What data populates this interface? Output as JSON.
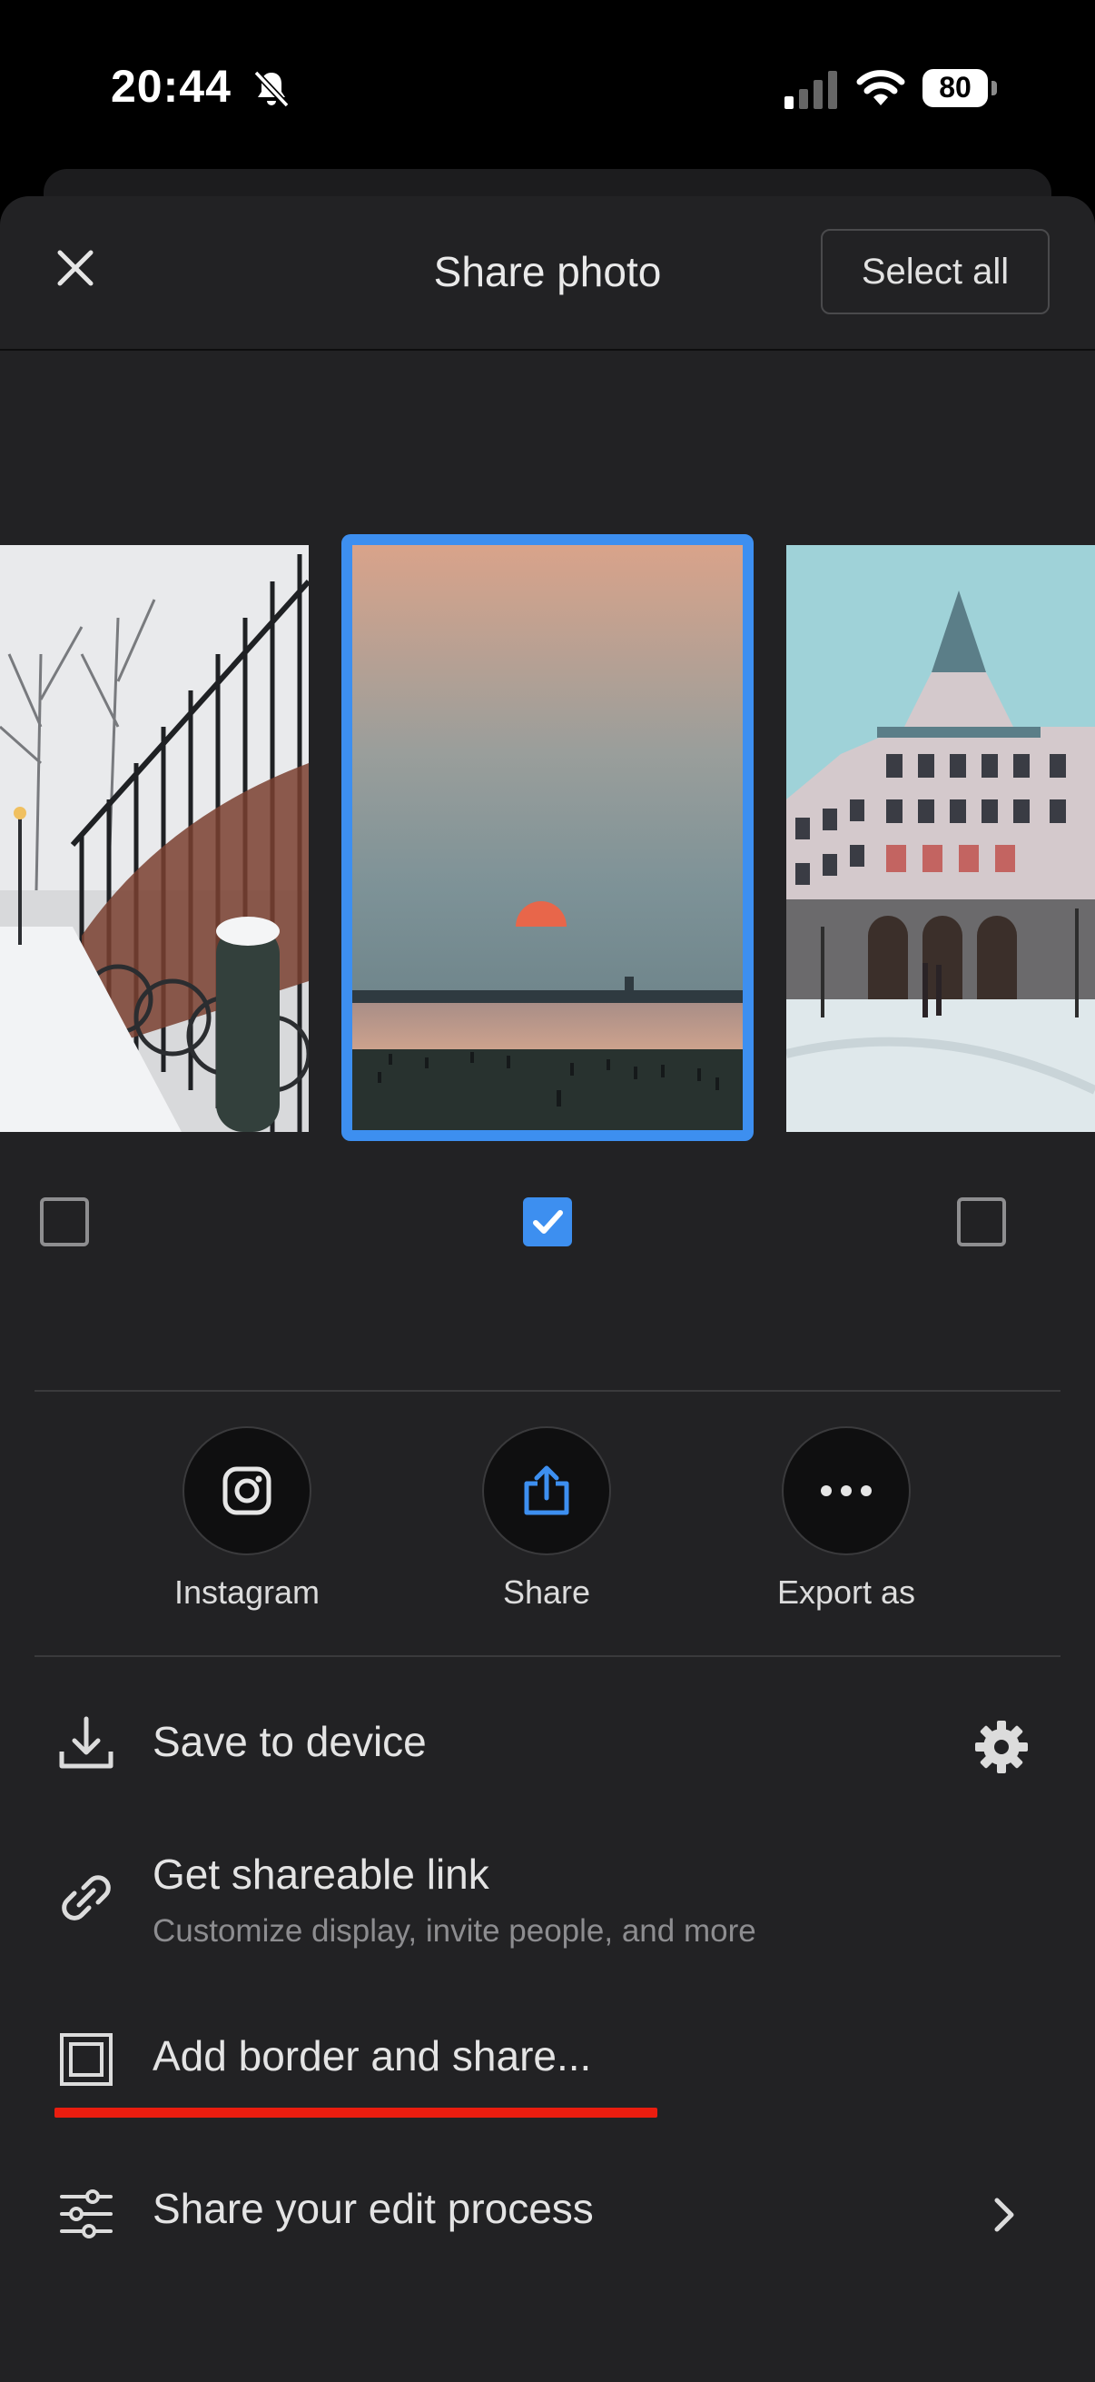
{
  "status_bar": {
    "time": "20:44",
    "battery": "80"
  },
  "header": {
    "title": "Share photo",
    "select_all_label": "Select all"
  },
  "carousel": {
    "checks": [
      false,
      true,
      false
    ]
  },
  "actions": [
    {
      "label": "Instagram",
      "icon": "instagram-icon"
    },
    {
      "label": "Share",
      "icon": "share-icon"
    },
    {
      "label": "Export as",
      "icon": "more-icon"
    }
  ],
  "options": {
    "save": {
      "label": "Save to device",
      "icon": "download-icon",
      "trailing_icon": "gear-icon"
    },
    "link": {
      "label": "Get shareable link",
      "sub": "Customize display, invite people, and more",
      "icon": "link-icon"
    },
    "border": {
      "label": "Add border and share...",
      "icon": "border-frame-icon"
    },
    "process": {
      "label": "Share your edit process",
      "icon": "sliders-icon",
      "trailing_icon": "chevron-right-icon"
    }
  },
  "colors": {
    "accent": "#3d8ff0",
    "highlight_underline": "#ea1d0f",
    "sheet": "#222224"
  }
}
